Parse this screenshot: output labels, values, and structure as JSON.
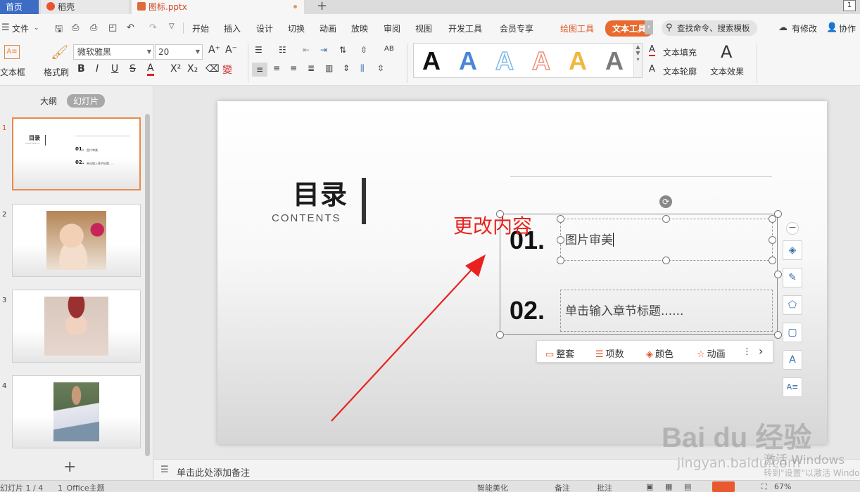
{
  "tabs": {
    "home": "首页",
    "wps": "稻壳",
    "doc": "图标.pptx",
    "page_num": "1"
  },
  "menu": {
    "file": "文件",
    "items": [
      "开始",
      "插入",
      "设计",
      "切换",
      "动画",
      "放映",
      "审阅",
      "视图",
      "开发工具",
      "会员专享"
    ],
    "draw_tool": "绘图工具",
    "text_tool": "文本工具",
    "search": "查找命令、搜索模板",
    "has_changes": "有修改",
    "collab": "协作"
  },
  "ribbon": {
    "textbox": "文本框",
    "format_painter": "格式刷",
    "font_name": "微软雅黑",
    "font_size": "20",
    "text_fill": "文本填充",
    "text_outline": "文本轮廓",
    "text_effect": "文本效果",
    "style_glyph": "A",
    "style_colors": [
      "#111111",
      "#4a86d8",
      "#7fb8e8",
      "#ef8f7e",
      "#f0b73c",
      "#7a7a7a"
    ]
  },
  "pane": {
    "outline_tab": "大纲",
    "slides_tab": "幻灯片",
    "thumbs": [
      {
        "num": "1",
        "title": "目录",
        "sub": "CONTENTS",
        "n1": "01.",
        "t1": "图片审美",
        "n2": "02.",
        "t2": "单击输入章节标题......"
      },
      {
        "num": "2"
      },
      {
        "num": "3"
      },
      {
        "num": "4"
      }
    ]
  },
  "slide": {
    "title": "目录",
    "subtitle": "CONTENTS",
    "annotation": "更改内容",
    "item1_num": "01.",
    "item1_text": "图片审美",
    "item2_num": "02.",
    "item2_text": "单击输入章节标题......"
  },
  "ctx": {
    "whole": "整套",
    "items": "项数",
    "color": "颜色",
    "anim": "动画",
    "more": "⋮",
    "next": "›"
  },
  "notes": {
    "placeholder": "单击此处添加备注"
  },
  "status": {
    "slide_count": "幻灯片 1 / 4",
    "theme": "1_Office主题",
    "smart_beautify": "智能美化",
    "notes": "备注",
    "comments": "批注",
    "zoom": "67%"
  },
  "watermark": {
    "logo": "Bai du 经验",
    "url": "jingyan.baidu.com",
    "activate": "激活 Windows",
    "activate_hint": "转到\"设置\"以激活 Windows。"
  }
}
